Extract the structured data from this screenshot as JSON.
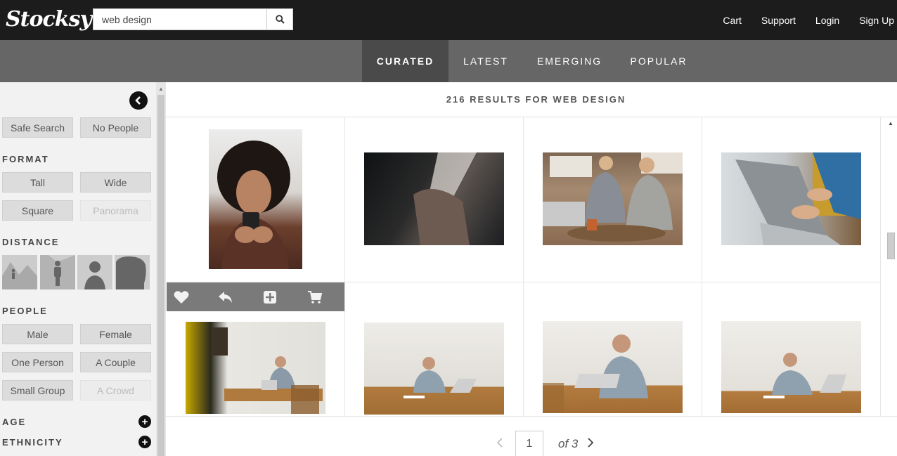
{
  "header": {
    "logo": "Stocksy",
    "search_value": "web design",
    "links": [
      "Cart",
      "Support",
      "Login",
      "Sign Up"
    ]
  },
  "tabs": [
    "CURATED",
    "LATEST",
    "EMERGING",
    "POPULAR"
  ],
  "active_tab": "CURATED",
  "sidebar": {
    "safe_search": "Safe Search",
    "no_people": "No People",
    "format_heading": "FORMAT",
    "format": [
      "Tall",
      "Wide",
      "Square",
      "Panorama"
    ],
    "distance_heading": "DISTANCE",
    "people_heading": "PEOPLE",
    "people": [
      "Male",
      "Female",
      "One Person",
      "A Couple",
      "Small Group",
      "A Crowd"
    ],
    "age_heading": "AGE",
    "ethnicity_heading": "ETHNICITY"
  },
  "results_text": "216 RESULTS FOR WEB DESIGN",
  "pagination": {
    "current": "1",
    "of_text": "of 3"
  },
  "colors": {
    "header_bg": "#1c1c1c",
    "tabbar_bg": "#666666",
    "active_tab_bg": "#4a4a4a",
    "sidebar_bg": "#f2f2f2"
  }
}
